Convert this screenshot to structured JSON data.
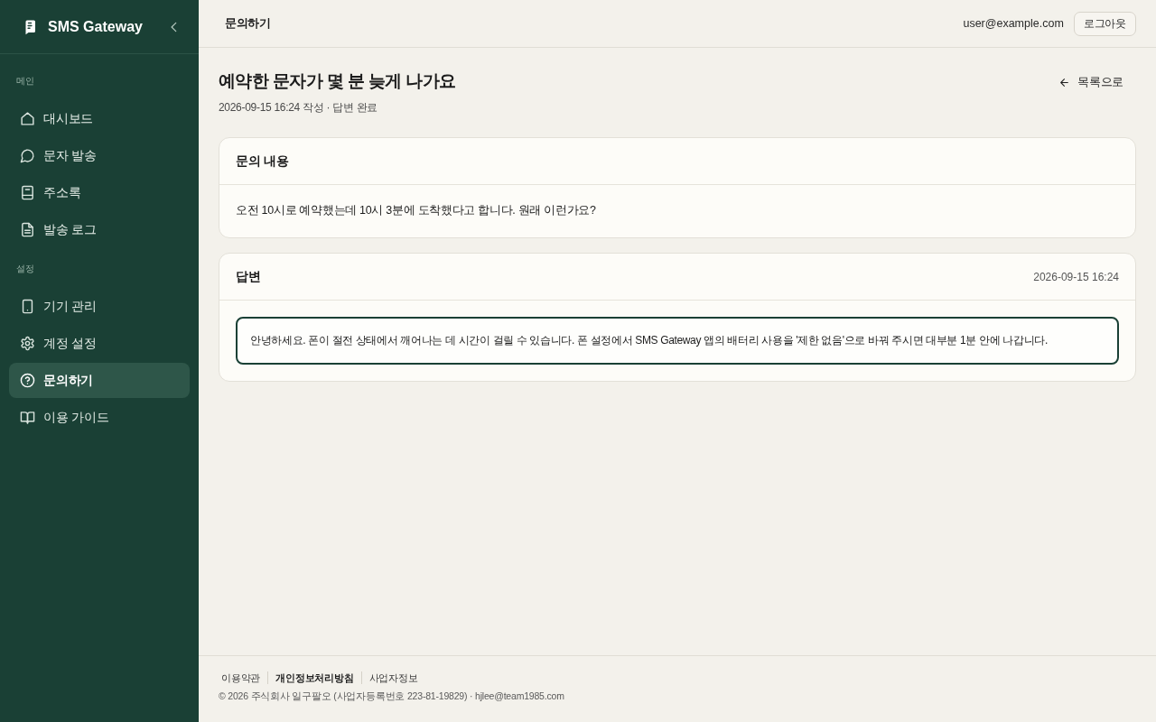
{
  "sidebar": {
    "brand": "SMS Gateway",
    "sections": [
      {
        "label": "메인",
        "items": [
          {
            "label": "대시보드",
            "selected": false
          },
          {
            "label": "문자 발송",
            "selected": false
          },
          {
            "label": "주소록",
            "selected": false
          },
          {
            "label": "발송 로그",
            "selected": false
          }
        ]
      },
      {
        "label": "설정",
        "items": [
          {
            "label": "기기 관리",
            "selected": false
          },
          {
            "label": "계정 설정",
            "selected": false
          },
          {
            "label": "문의하기",
            "selected": true
          },
          {
            "label": "이용 가이드",
            "selected": false
          }
        ]
      }
    ]
  },
  "header": {
    "title": "문의하기",
    "user": "user@example.com",
    "logout": "로그아웃"
  },
  "page": {
    "title": "예약한 문자가 몇 분 늦게 나가요",
    "meta": "2026-09-15 16:24 작성 · 답변 완료",
    "back": "목록으로"
  },
  "question": {
    "heading": "문의 내용",
    "body": "오전 10시로 예약했는데 10시 3분에 도착했다고 합니다. 원래 이런가요?"
  },
  "answer": {
    "heading": "답변",
    "date": "2026-09-15 16:24",
    "body": "안녕하세요. 폰이 절전 상태에서 깨어나는 데 시간이 걸릴 수 있습니다. 폰 설정에서 SMS Gateway 앱의 배터리 사용을 '제한 없음'으로 바꿔 주시면 대부분 1분 안에 나갑니다."
  },
  "footer": {
    "links": [
      {
        "label": "이용약관",
        "emphasized": false
      },
      {
        "label": "개인정보처리방침",
        "emphasized": true
      },
      {
        "label": "사업자정보",
        "emphasized": false
      }
    ],
    "copyright": "© 2026 주식회사 일구팔오 (사업자등록번호 223-81-19829) · hjlee@team1985.com"
  }
}
